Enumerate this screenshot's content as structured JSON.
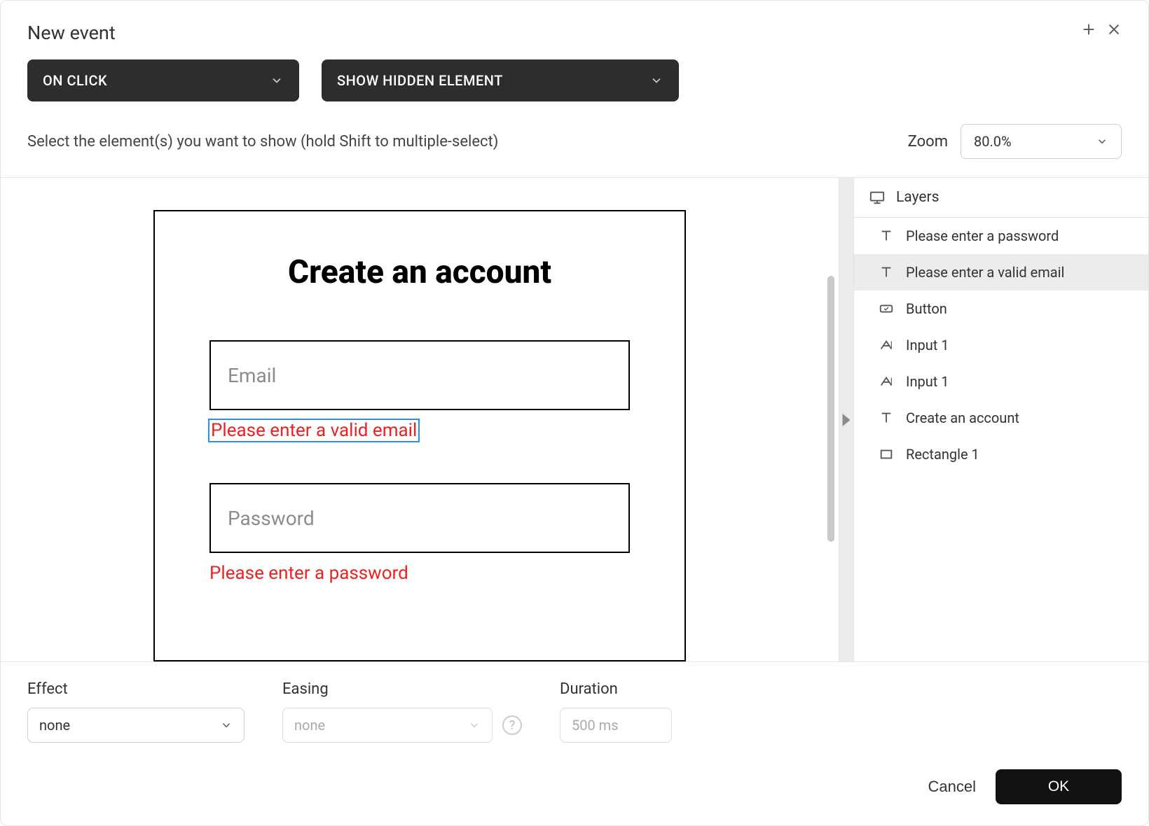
{
  "dialog": {
    "title": "New event",
    "trigger_select": "ON CLICK",
    "action_select": "SHOW HIDDEN ELEMENT",
    "instruction": "Select the element(s) you want to show (hold Shift to multiple-select)",
    "zoom_label": "Zoom",
    "zoom_value": "80.0%"
  },
  "artboard": {
    "title": "Create an account",
    "email_placeholder": "Email",
    "email_error": "Please enter a valid email",
    "password_placeholder": "Password",
    "password_error": "Please enter a password"
  },
  "layers": {
    "title": "Layers",
    "items": [
      {
        "icon": "text",
        "label": "Please enter a password",
        "selected": false
      },
      {
        "icon": "text",
        "label": "Please enter a valid email",
        "selected": true
      },
      {
        "icon": "button",
        "label": "Button",
        "selected": false
      },
      {
        "icon": "input",
        "label": "Input 1",
        "selected": false
      },
      {
        "icon": "input",
        "label": "Input 1",
        "selected": false
      },
      {
        "icon": "text",
        "label": "Create an account",
        "selected": false
      },
      {
        "icon": "rect",
        "label": "Rectangle 1",
        "selected": false
      }
    ]
  },
  "controls": {
    "effect_label": "Effect",
    "effect_value": "none",
    "easing_label": "Easing",
    "easing_value": "none",
    "duration_label": "Duration",
    "duration_value": "500 ms"
  },
  "footer": {
    "cancel": "Cancel",
    "ok": "OK"
  }
}
